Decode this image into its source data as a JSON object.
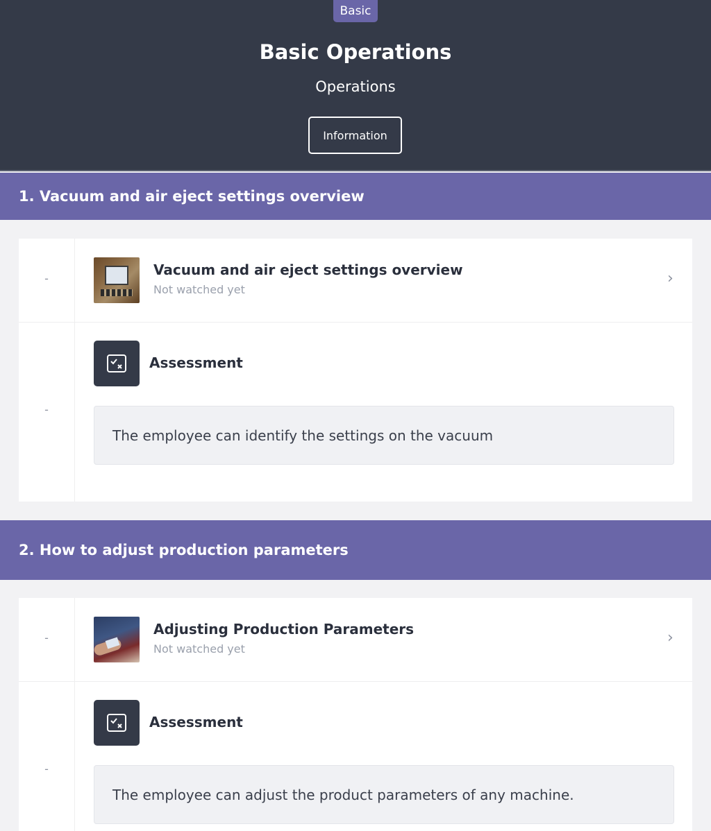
{
  "header": {
    "badge": "Basic",
    "title": "Basic Operations",
    "subtitle": "Operations",
    "info_button": "Information"
  },
  "sections": [
    {
      "heading": "1. Vacuum and air eject settings overview",
      "video": {
        "title": "Vacuum and air eject settings overview",
        "status": "Not watched yet",
        "marker": "-"
      },
      "assessment": {
        "label": "Assessment",
        "text": "The employee can identify the settings on the vacuum",
        "marker": "-"
      }
    },
    {
      "heading": "2. How to adjust production parameters",
      "video": {
        "title": "Adjusting Production Parameters",
        "status": "Not watched yet",
        "marker": "-"
      },
      "assessment": {
        "label": "Assessment",
        "text": "The employee can adjust the product parameters of any machine.",
        "marker": "-"
      }
    }
  ],
  "icons": {
    "chevron": "chevron-right-icon",
    "assessment": "checklist-icon"
  },
  "colors": {
    "header_bg": "#343a48",
    "accent": "#6a66a8",
    "page_bg": "#f2f2f4"
  }
}
